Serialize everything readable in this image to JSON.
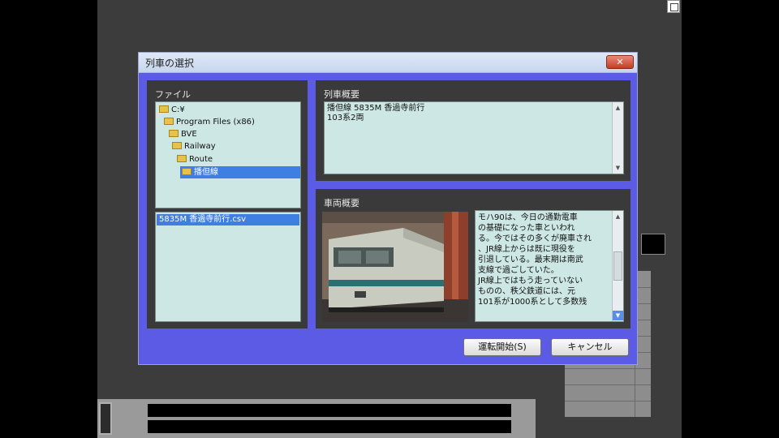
{
  "dialog": {
    "title": "列車の選択",
    "close_label": "✕",
    "file_pane": {
      "label": "ファイル",
      "tree": [
        {
          "label": "C:¥",
          "selected": false
        },
        {
          "label": "Program Files (x86)",
          "selected": false
        },
        {
          "label": "BVE",
          "selected": false
        },
        {
          "label": "Railway",
          "selected": false
        },
        {
          "label": "Route",
          "selected": false
        },
        {
          "label": "播但線",
          "selected": true
        }
      ],
      "files": [
        "5835M 香過寺前行.csv"
      ]
    },
    "train_summary": {
      "label": "列車概要",
      "lines": [
        "播但線 5835M 香過寺前行",
        "103系2両"
      ]
    },
    "vehicle_summary": {
      "label": "車両概要",
      "description": "モハ90は、今日の通勤電車\nの基礎になった車といわれ\nる。今ではその多くが廃車され\n、JR線上からは既に現役を\n引退している。最末期は南武\n支線で過ごしていた。\nJR線上ではもう走っていない\nものの、秩父鉄道には、元\n101系が1000系として多数残"
    },
    "buttons": {
      "start": "運転開始(S)",
      "cancel": "キャンセル"
    }
  },
  "icons": {
    "folder": "folder-icon",
    "scroll_up": "scroll-up-arrow-icon",
    "scroll_down": "scroll-down-arrow-icon"
  }
}
